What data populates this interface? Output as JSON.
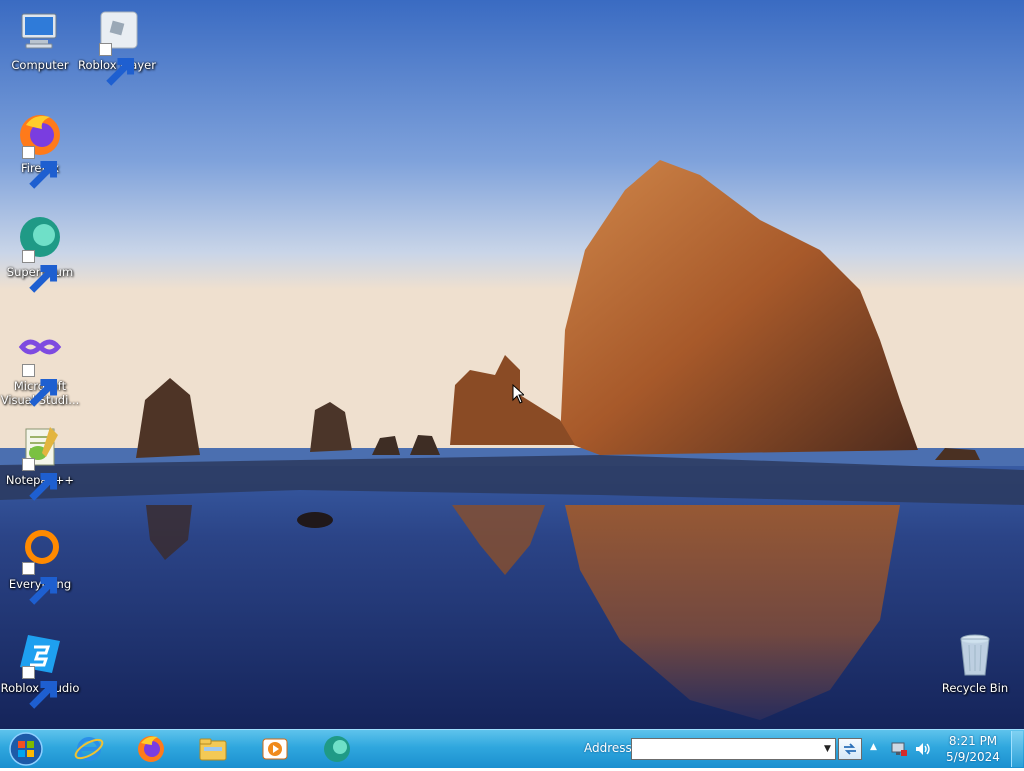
{
  "desktop": {
    "icons": [
      {
        "label": "Computer",
        "icon": "computer-icon",
        "shortcut": false
      },
      {
        "label": "Roblox Player",
        "icon": "roblox-player-icon",
        "shortcut": true
      },
      {
        "label": "Firefox",
        "icon": "firefox-icon",
        "shortcut": true
      },
      {
        "label": "Supermium",
        "icon": "supermium-icon",
        "shortcut": true
      },
      {
        "label": "Microsoft Visual Studi...",
        "icon": "visual-studio-icon",
        "shortcut": true
      },
      {
        "label": "Notepad++",
        "icon": "notepadpp-icon",
        "shortcut": true
      },
      {
        "label": "Everything",
        "icon": "everything-icon",
        "shortcut": true
      },
      {
        "label": "Roblox Studio",
        "icon": "roblox-studio-icon",
        "shortcut": true
      },
      {
        "label": "Recycle Bin",
        "icon": "recycle-bin-icon",
        "shortcut": false
      }
    ]
  },
  "taskbar": {
    "start_icon": "windows-orb-icon",
    "pinned": [
      {
        "name": "Internet Explorer",
        "icon": "internet-explorer-icon"
      },
      {
        "name": "Firefox",
        "icon": "firefox-icon"
      },
      {
        "name": "Windows Explorer",
        "icon": "file-explorer-icon"
      },
      {
        "name": "Windows Media Player",
        "icon": "media-player-icon"
      },
      {
        "name": "Supermium",
        "icon": "supermium-icon"
      }
    ],
    "address": {
      "label": "Address",
      "value": ""
    },
    "tray": {
      "icons": [
        "show-hidden-icons-chevron",
        "network-icon",
        "volume-icon"
      ],
      "time": "8:21 PM",
      "date": "5/9/2024"
    }
  },
  "colors": {
    "taskbar_top": "#5ec3ec",
    "taskbar_bottom": "#1b8fcf",
    "sky_top": "#3f6ec1",
    "rock": "#b5652a",
    "water": "#22377a"
  }
}
